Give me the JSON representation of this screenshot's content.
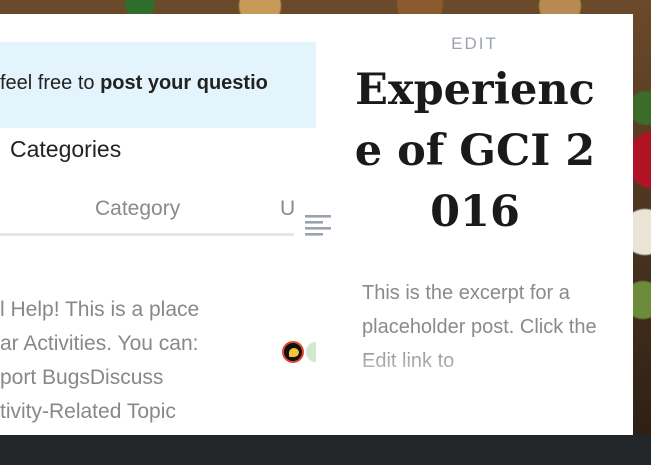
{
  "embedded_page": {
    "banner": {
      "prefix": "feel free to ",
      "bold": "post your questio"
    },
    "categories_title": "Categories",
    "table_headers": {
      "category": "Category",
      "users_partial": "U"
    },
    "category_description_lines": [
      "l Help! This is a place",
      "ar Activities. You can:",
      "port BugsDiscuss",
      "tivity-Related Topic"
    ]
  },
  "post": {
    "edit_label": "EDIT",
    "title": "Experience of GCI 2016",
    "excerpt": "This is the excerpt for a placeholder post. Click the Edit link to"
  },
  "icons": {
    "format_icon": "text-align-left-icon",
    "avatar": "user-avatar"
  },
  "colors": {
    "banner_bg": "#e3f4fd",
    "edit_link": "#9aa3ad",
    "footer": "#24272a"
  }
}
